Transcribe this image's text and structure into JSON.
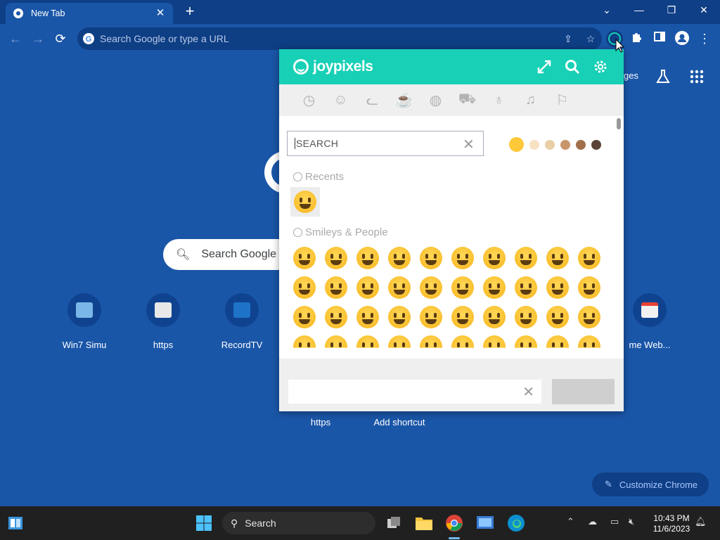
{
  "browser": {
    "tab": {
      "title": "New Tab"
    },
    "omnibox": {
      "placeholder": "Search Google or type a URL"
    }
  },
  "ntp": {
    "images_link_partial": "ges",
    "search_placeholder": "Search Google o",
    "shortcuts": [
      {
        "label": "Win7 Simu"
      },
      {
        "label": "https"
      },
      {
        "label": "RecordTV"
      },
      {
        "label": "me Web..."
      },
      {
        "label": "https"
      },
      {
        "label": "Add shortcut"
      }
    ],
    "customize_label": "Customize Chrome"
  },
  "joypixels": {
    "brand": "joypixels",
    "categories": [
      "recents",
      "smileys",
      "animals",
      "food",
      "activity",
      "travel",
      "objects",
      "symbols",
      "flags"
    ],
    "search_placeholder": "SEARCH",
    "skin_tones": [
      "#fdc83a",
      "#f7e1c3",
      "#e8cfa6",
      "#c9956b",
      "#a1704b",
      "#5b4436"
    ],
    "sections": {
      "recents": "Recents",
      "smileys": "Smileys & People"
    },
    "recent_emoji_name": "smiling face with open hands",
    "emoji_rows": 4,
    "emoji_cols": 10,
    "output_value": ""
  },
  "taskbar": {
    "search_label": "Search",
    "time": "10:43 PM",
    "date": "11/6/2023"
  }
}
